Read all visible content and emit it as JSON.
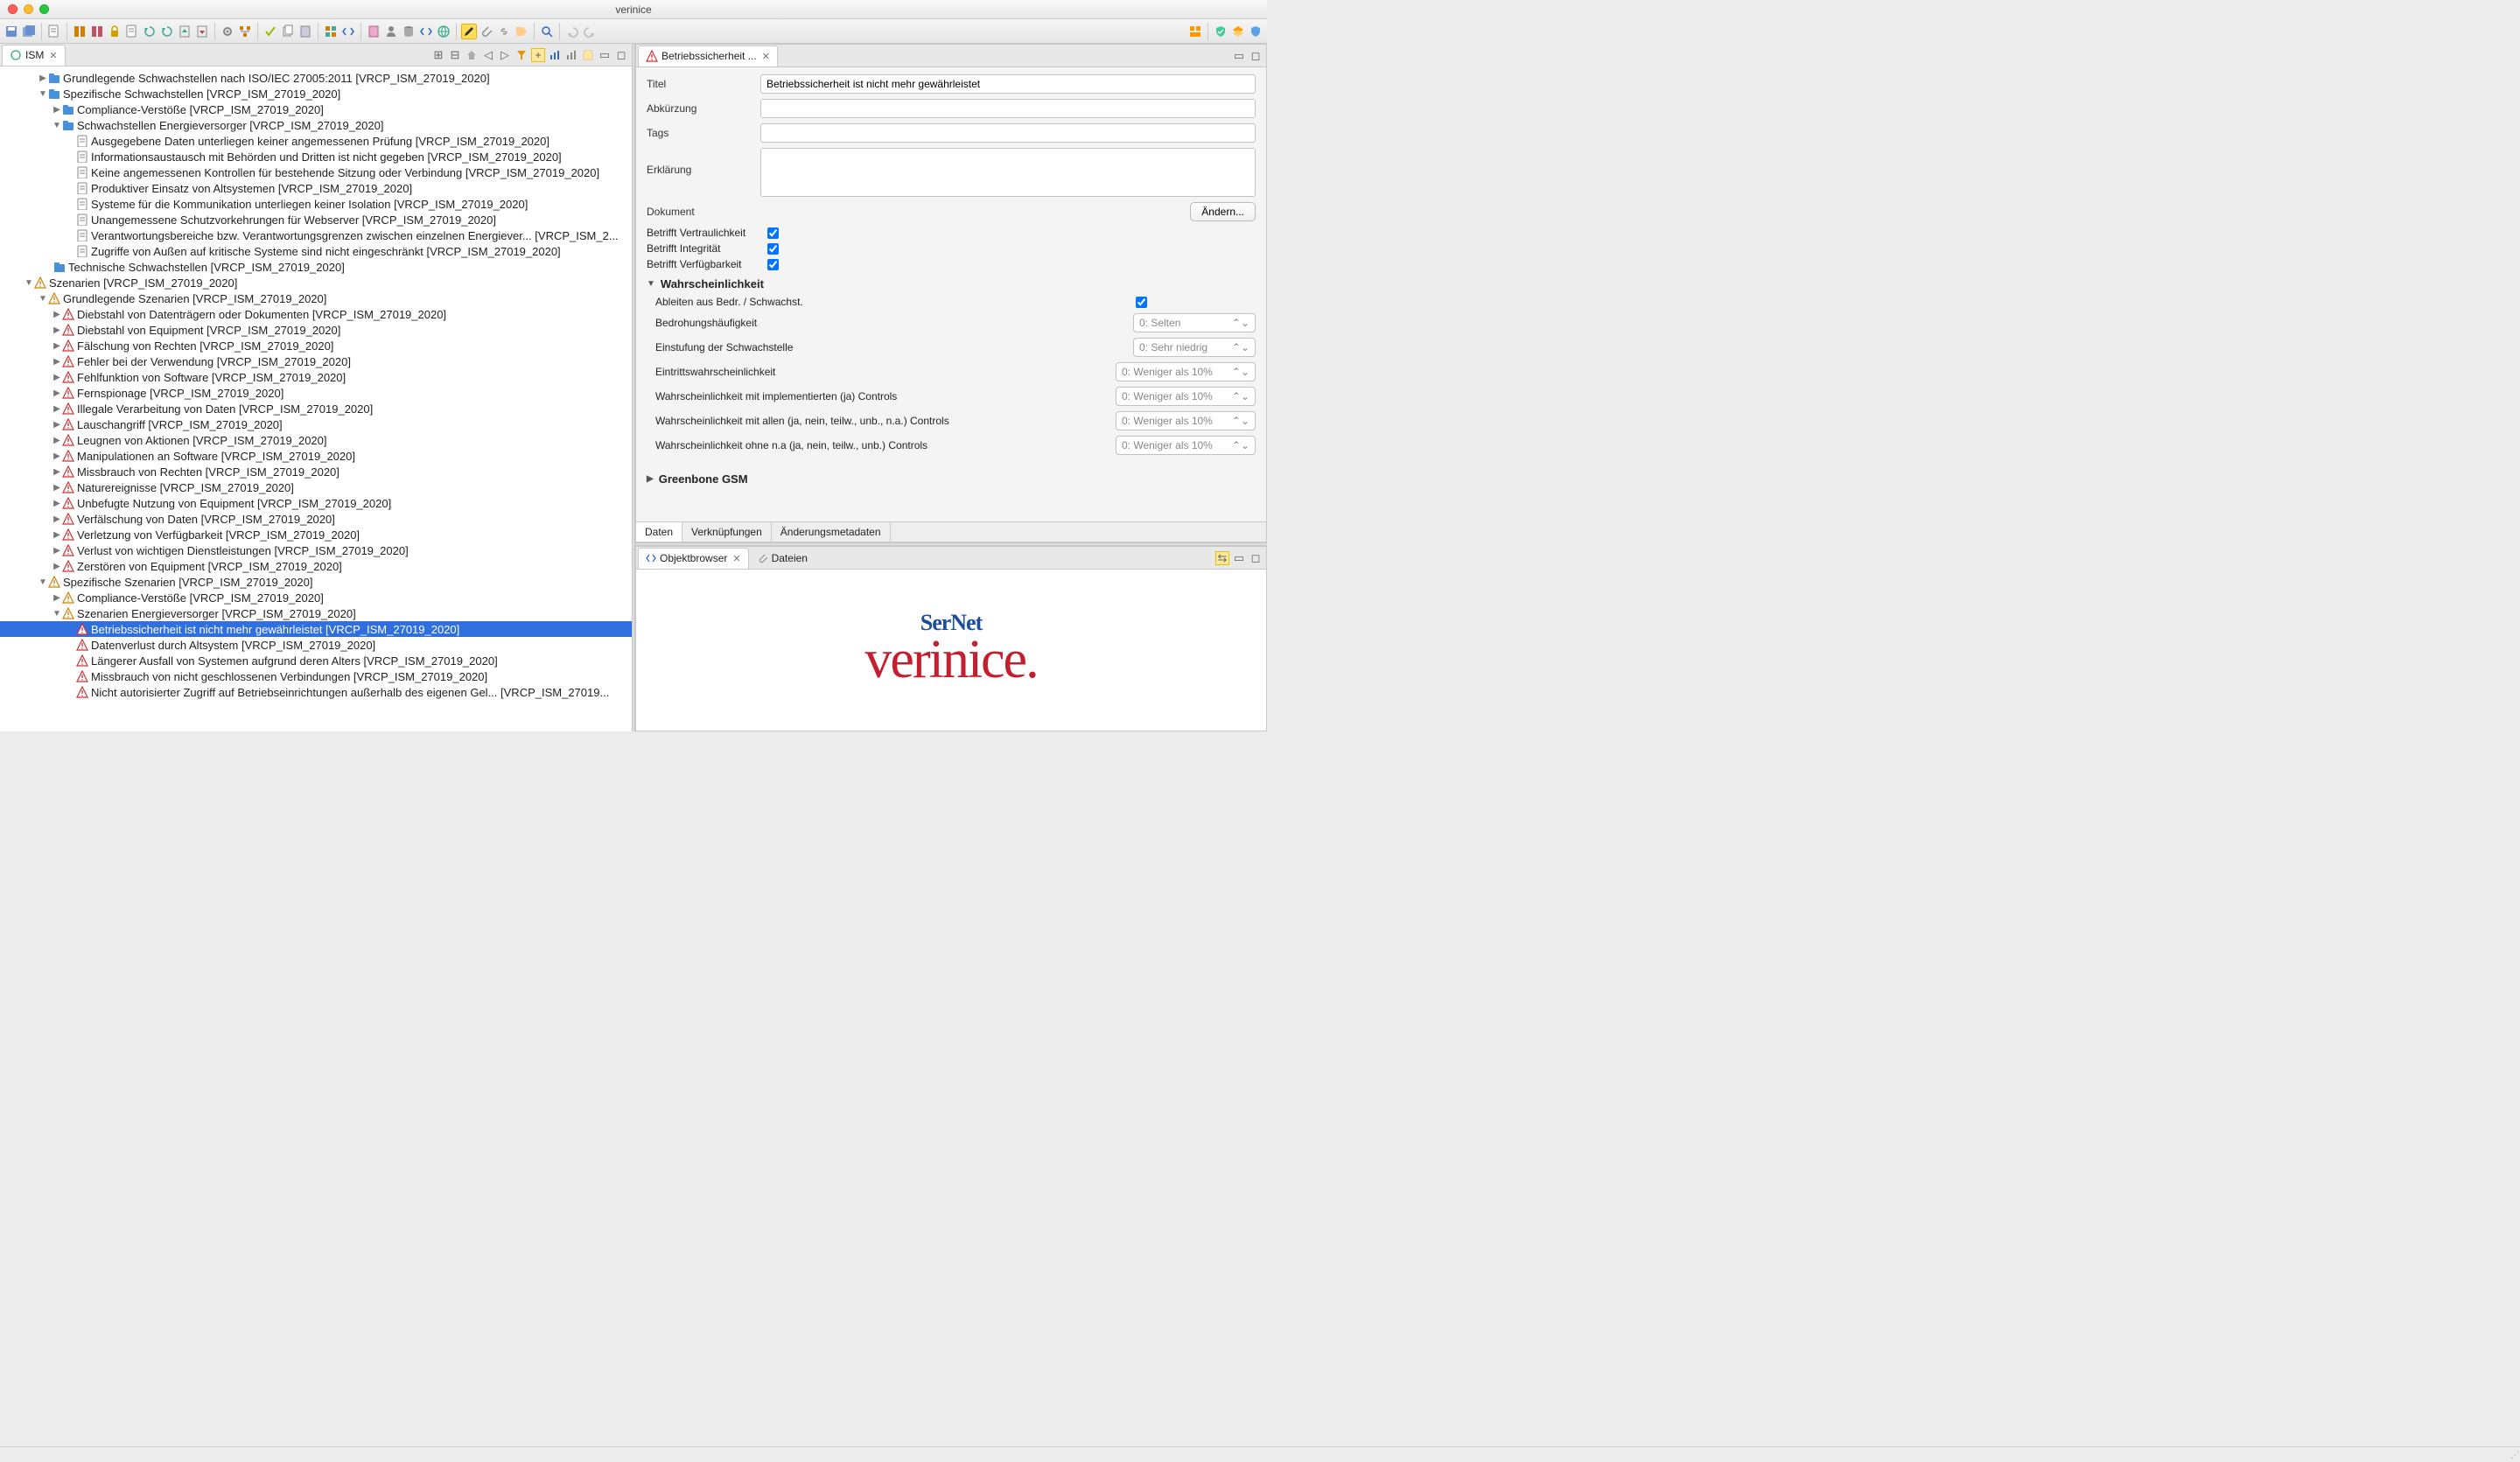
{
  "window": {
    "title": "verinice"
  },
  "left_tab": {
    "label": "ISM"
  },
  "right_tab": {
    "label": "Betriebssicherheit ..."
  },
  "obj_tab": {
    "label": "Objektbrowser"
  },
  "files_tab": {
    "label": "Dateien"
  },
  "tree": {
    "n0": "Grundlegende Schwachstellen nach ISO/IEC 27005:2011 [VRCP_ISM_27019_2020]",
    "n1": "Spezifische Schwachstellen [VRCP_ISM_27019_2020]",
    "n1a": "Compliance-Verstöße [VRCP_ISM_27019_2020]",
    "n1b": "Schwachstellen Energieversorger [VRCP_ISM_27019_2020]",
    "n1b1": "Ausgegebene Daten unterliegen keiner angemessenen Prüfung [VRCP_ISM_27019_2020]",
    "n1b2": "Informationsaustausch mit Behörden und Dritten ist nicht gegeben [VRCP_ISM_27019_2020]",
    "n1b3": "Keine angemessenen Kontrollen für bestehende Sitzung oder Verbindung [VRCP_ISM_27019_2020]",
    "n1b4": "Produktiver Einsatz von Altsystemen [VRCP_ISM_27019_2020]",
    "n1b5": "Systeme für die Kommunikation unterliegen keiner Isolation [VRCP_ISM_27019_2020]",
    "n1b6": "Unangemessene Schutzvorkehrungen für Webserver [VRCP_ISM_27019_2020]",
    "n1b7": "Verantwortungsbereiche bzw. Verantwortungsgrenzen zwischen einzelnen Energiever... [VRCP_ISM_2...",
    "n1b8": "Zugriffe von Außen auf kritische Systeme sind nicht eingeschränkt [VRCP_ISM_27019_2020]",
    "n1c": "Technische Schwachstellen [VRCP_ISM_27019_2020]",
    "n2": "Szenarien [VRCP_ISM_27019_2020]",
    "n2a": "Grundlegende Szenarien [VRCP_ISM_27019_2020]",
    "s1": "Diebstahl von Datenträgern oder Dokumenten [VRCP_ISM_27019_2020]",
    "s2": "Diebstahl von Equipment [VRCP_ISM_27019_2020]",
    "s3": "Fälschung von Rechten  [VRCP_ISM_27019_2020]",
    "s4": "Fehler bei der Verwendung [VRCP_ISM_27019_2020]",
    "s5": "Fehlfunktion von Software [VRCP_ISM_27019_2020]",
    "s6": "Fernspionage [VRCP_ISM_27019_2020]",
    "s7": "Illegale Verarbeitung von Daten [VRCP_ISM_27019_2020]",
    "s8": "Lauschangriff [VRCP_ISM_27019_2020]",
    "s9": "Leugnen von Aktionen [VRCP_ISM_27019_2020]",
    "s10": "Manipulationen an Software [VRCP_ISM_27019_2020]",
    "s11": "Missbrauch von Rechten [VRCP_ISM_27019_2020]",
    "s12": "Naturereignisse [VRCP_ISM_27019_2020]",
    "s13": "Unbefugte Nutzung von Equipment [VRCP_ISM_27019_2020]",
    "s14": "Verfälschung von Daten [VRCP_ISM_27019_2020]",
    "s15": "Verletzung von Verfügbarkeit [VRCP_ISM_27019_2020]",
    "s16": "Verlust von wichtigen Dienstleistungen [VRCP_ISM_27019_2020]",
    "s17": "Zerstören von Equipment [VRCP_ISM_27019_2020]",
    "n2b": "Spezifische Szenarien [VRCP_ISM_27019_2020]",
    "n2b1": "Compliance-Verstöße [VRCP_ISM_27019_2020]",
    "n2b2": "Szenarien Energieversorger [VRCP_ISM_27019_2020]",
    "e1": "Betriebssicherheit ist nicht mehr gewährleistet [VRCP_ISM_27019_2020]",
    "e2": "Datenverlust durch Altsystem [VRCP_ISM_27019_2020]",
    "e3": "Längerer Ausfall von Systemen aufgrund deren Alters [VRCP_ISM_27019_2020]",
    "e4": "Missbrauch von nicht geschlossenen Verbindungen [VRCP_ISM_27019_2020]",
    "e5": "Nicht autorisierter Zugriff auf Betriebseinrichtungen außerhalb des eigenen Gel... [VRCP_ISM_27019..."
  },
  "form": {
    "titel_label": "Titel",
    "titel_value": "Betriebssicherheit ist nicht mehr gewährleistet",
    "abk_label": "Abkürzung",
    "abk_value": "",
    "tags_label": "Tags",
    "tags_value": "",
    "erkl_label": "Erklärung",
    "erkl_value": "",
    "dok_label": "Dokument",
    "dok_btn": "Ändern...",
    "c1": "Betrifft Vertraulichkeit",
    "c2": "Betrifft Integrität",
    "c3": "Betrifft Verfügbarkeit",
    "sec1": "Wahrscheinlichkeit",
    "abl": "Ableiten aus Bedr. / Schwachst.",
    "r1l": "Bedrohungshäufigkeit",
    "r1v": "0: Selten",
    "r2l": "Einstufung der Schwachstelle",
    "r2v": "0: Sehr niedrig",
    "r3l": "Eintrittswahrscheinlichkeit",
    "r3v": "0: Weniger als 10%",
    "r4l": "Wahrscheinlichkeit mit implementierten (ja) Controls",
    "r4v": "0: Weniger als 10%",
    "r5l": "Wahrscheinlichkeit mit allen (ja, nein, teilw., unb., n.a.) Controls",
    "r5v": "0: Weniger als 10%",
    "r6l": "Wahrscheinlichkeit ohne n.a (ja, nein, teilw., unb.) Controls",
    "r6v": "0: Weniger als 10%",
    "sec2": "Greenbone GSM",
    "bt1": "Daten",
    "bt2": "Verknüpfungen",
    "bt3": "Änderungsmetadaten"
  },
  "brand": {
    "ser": "SerNet",
    "ver": "verinice."
  }
}
